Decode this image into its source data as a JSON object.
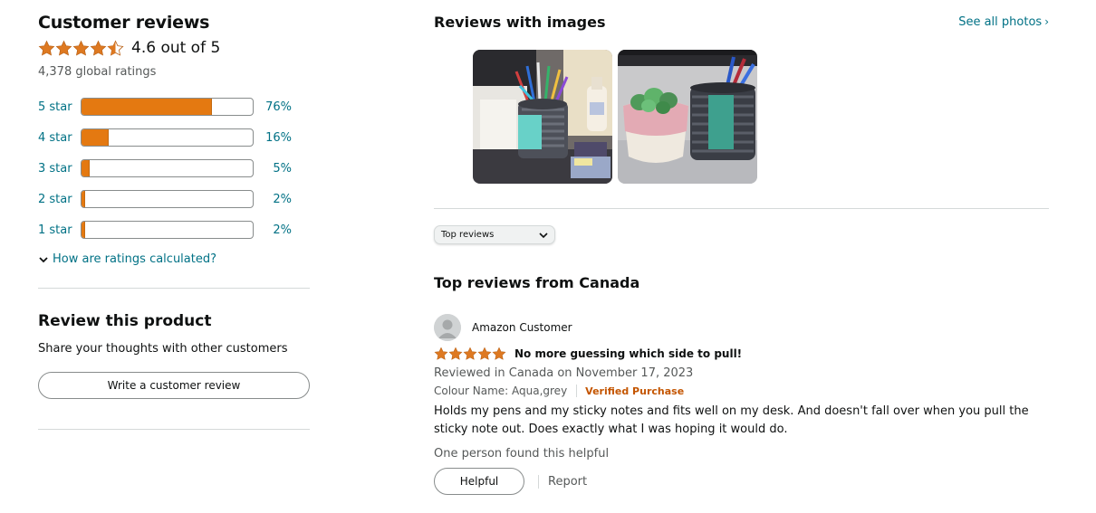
{
  "summary": {
    "title": "Customer reviews",
    "rating_value": 4.6,
    "rating_text": "4.6 out of 5",
    "global_ratings": "4,378 global ratings",
    "histogram": [
      {
        "label": "5 star",
        "percent_text": "76%",
        "fraction": 0.76
      },
      {
        "label": "4 star",
        "percent_text": "16%",
        "fraction": 0.16
      },
      {
        "label": "3 star",
        "percent_text": "5%",
        "fraction": 0.05
      },
      {
        "label": "2 star",
        "percent_text": "2%",
        "fraction": 0.02
      },
      {
        "label": "1 star",
        "percent_text": "2%",
        "fraction": 0.02
      }
    ],
    "how_calculated": "How are ratings calculated?"
  },
  "review_product": {
    "title": "Review this product",
    "subtitle": "Share your thoughts with other customers",
    "button_label": "Write a customer review"
  },
  "images_section": {
    "title": "Reviews with images",
    "see_all": "See all photos"
  },
  "sort": {
    "selected": "Top reviews"
  },
  "top_reviews": {
    "title": "Top reviews from Canada",
    "reviews": [
      {
        "author": "Amazon Customer",
        "stars": 5,
        "title": "No more guessing which side to pull!",
        "date_line": "Reviewed in Canada on November 17, 2023",
        "attribute": "Colour Name: Aqua,grey",
        "verified": "Verified Purchase",
        "body": "Holds my pens and my sticky notes and fits well on my desk. And doesn't fall over when you pull the sticky note out. Does exactly what I was hoping it would do.",
        "helpful_count": "One person found this helpful",
        "helpful_label": "Helpful",
        "report_label": "Report"
      }
    ]
  },
  "colors": {
    "star": "#de7921",
    "bar_fill": "#e47911",
    "link": "#007185",
    "verified": "#c45500"
  },
  "icons": {
    "star": "star-icon",
    "half_star": "half-star-icon",
    "chevron_down": "chevron-down-icon",
    "chevron_right": "chevron-right-icon",
    "avatar": "user-avatar-icon"
  }
}
